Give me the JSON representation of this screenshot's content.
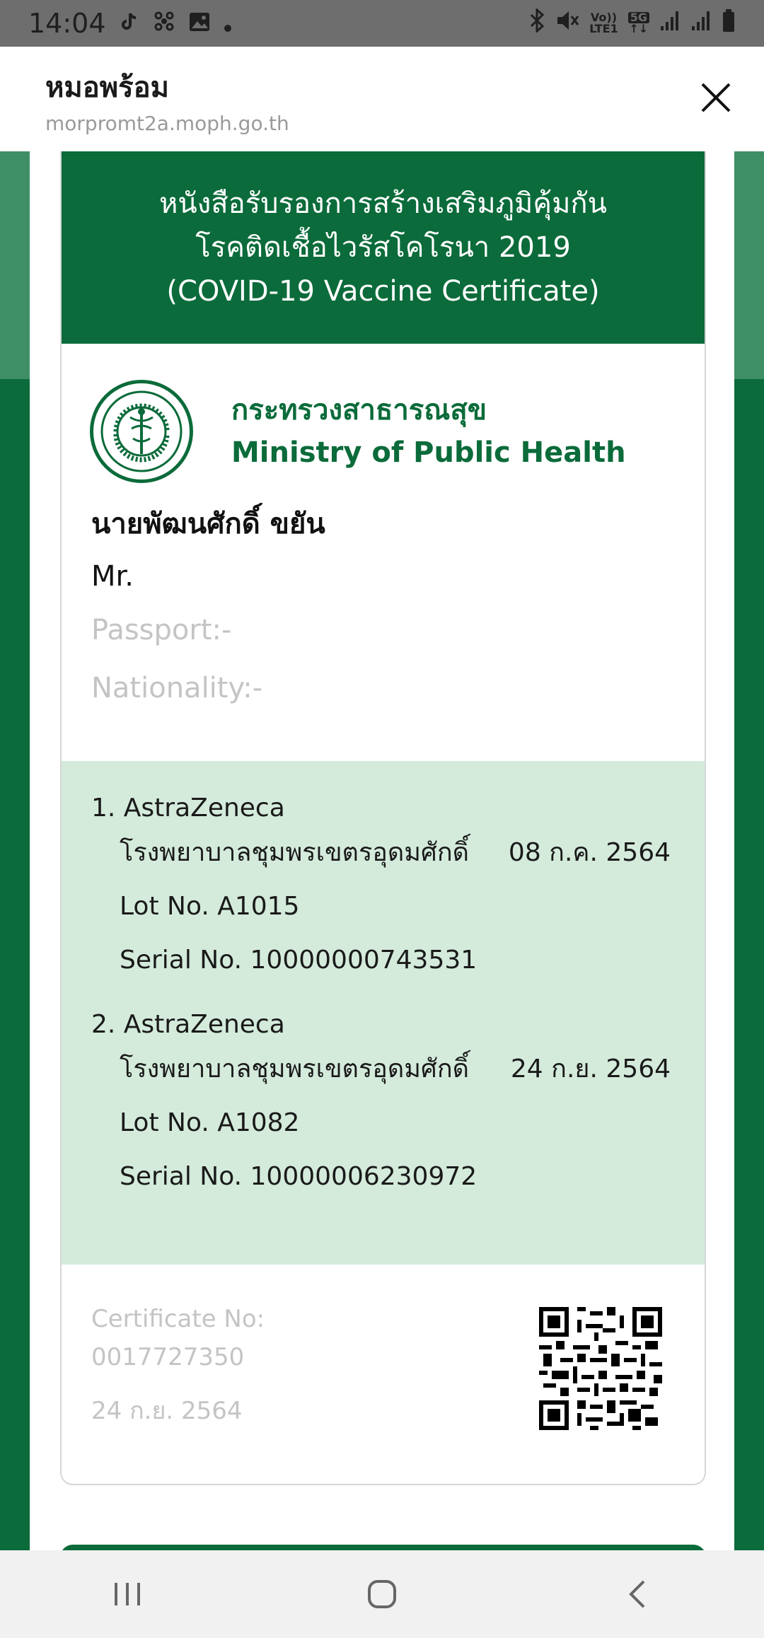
{
  "status_bar": {
    "time": "14:04",
    "volte": "Vo))",
    "lte": "LTE1",
    "network": "5G"
  },
  "app_header": {
    "title": "หมอพร้อม",
    "url": "morpromt2a.moph.go.th"
  },
  "certificate": {
    "title_line1": "หนังสือรับรองการสร้างเสริมภูมิคุ้มกัน",
    "title_line2": "โรคติดเชื้อไวรัสโคโรนา 2019",
    "title_line3": "(COVID-19 Vaccine Certificate)",
    "ministry_th": "กระทรวงสาธารณสุข",
    "ministry_en": "Ministry of Public Health",
    "name_th": "นายพัฒนศักดิ์ ขยัน",
    "name_en": "Mr.",
    "passport": "Passport:-",
    "nationality": "Nationality:-",
    "doses": [
      {
        "title": "1. AstraZeneca",
        "hospital": "โรงพยาบาลชุมพรเขตรอุดมศักดิ์",
        "date": "08 ก.ค. 2564",
        "lot": "Lot No. A1015",
        "serial": "Serial No. 10000000743531"
      },
      {
        "title": "2. AstraZeneca",
        "hospital": "โรงพยาบาลชุมพรเขตรอุดมศักดิ์",
        "date": "24 ก.ย. 2564",
        "lot": "Lot No. A1082",
        "serial": "Serial No. 10000006230972"
      }
    ],
    "cert_no_label": "Certificate No:",
    "cert_no": "0017727350",
    "issue_date": "24 ก.ย. 2564"
  },
  "colors": {
    "brand_green": "#0b6b3a",
    "dose_bg": "#d4ebdc"
  },
  "icons": {
    "close": "close-icon",
    "seal": "ministry-seal-icon",
    "qr": "qr-code-icon",
    "nav_recent": "recent-apps-icon",
    "nav_home": "home-icon",
    "nav_back": "back-icon"
  }
}
